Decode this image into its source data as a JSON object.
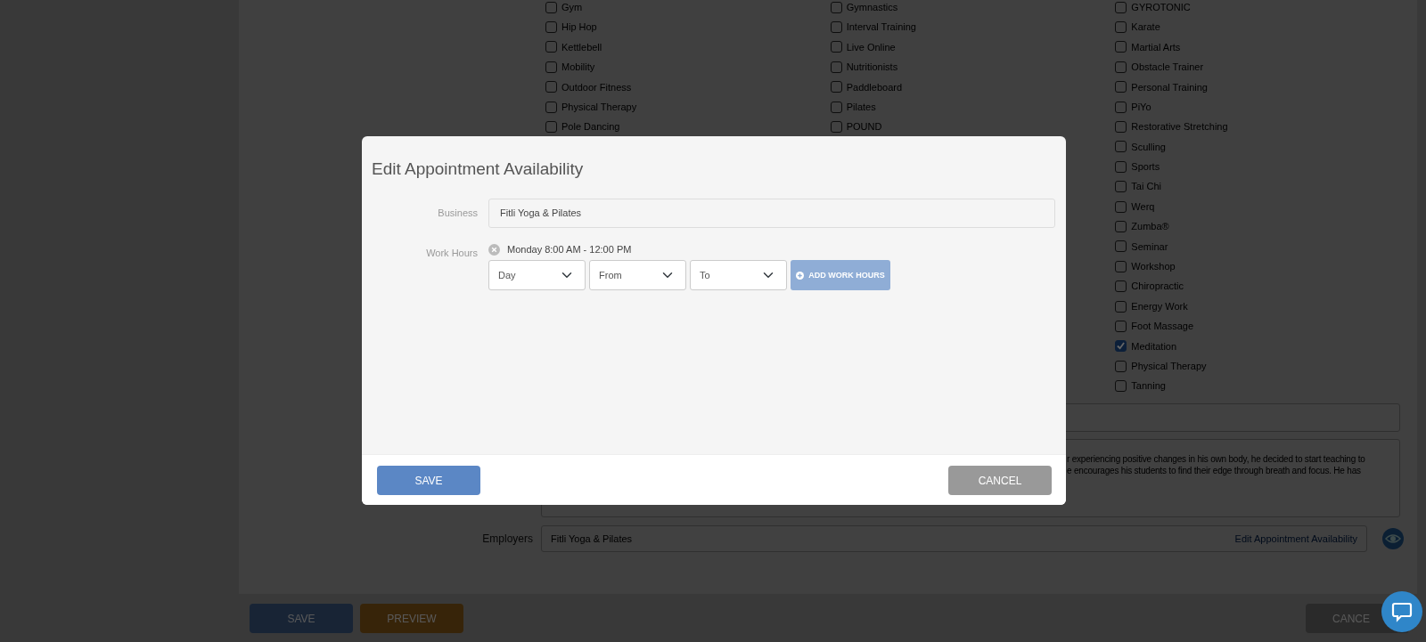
{
  "page": {
    "specialty_columns": [
      {
        "items": [
          {
            "label": "Gym",
            "checked": false
          },
          {
            "label": "Hip Hop",
            "checked": false
          },
          {
            "label": "Kettlebell",
            "checked": false
          },
          {
            "label": "Mobility",
            "checked": false
          },
          {
            "label": "Outdoor Fitness",
            "checked": false
          },
          {
            "label": "Physical Therapy",
            "checked": false
          },
          {
            "label": "Pole Dancing",
            "checked": false
          }
        ]
      },
      {
        "items": [
          {
            "label": "Gymnastics",
            "checked": false
          },
          {
            "label": "Interval Training",
            "checked": false
          },
          {
            "label": "Live Online",
            "checked": false
          },
          {
            "label": "Nutritionists",
            "checked": false
          },
          {
            "label": "Paddleboard",
            "checked": false
          },
          {
            "label": "Pilates",
            "checked": false
          },
          {
            "label": "POUND",
            "checked": false
          }
        ]
      },
      {
        "items": [
          {
            "label": "GYROTONIC",
            "checked": false
          },
          {
            "label": "Karate",
            "checked": false
          },
          {
            "label": "Martial Arts",
            "checked": false
          },
          {
            "label": "Obstacle Trainer",
            "checked": false
          },
          {
            "label": "Personal Training",
            "checked": false
          },
          {
            "label": "PiYo",
            "checked": false
          },
          {
            "label": "Restorative Stretching",
            "checked": false
          },
          {
            "label": "Sculling",
            "checked": false
          },
          {
            "label": "Sports",
            "checked": false
          },
          {
            "label": "Tai Chi",
            "checked": false
          },
          {
            "label": "Werq",
            "checked": false
          },
          {
            "label": "Zumba®",
            "checked": false
          },
          {
            "label": "Seminar",
            "checked": false
          },
          {
            "label": "Workshop",
            "checked": false
          },
          {
            "label": "Chiropractic",
            "checked": false
          },
          {
            "label": "Energy Work",
            "checked": false
          },
          {
            "label": "Foot Massage",
            "checked": false
          },
          {
            "label": "Meditation",
            "checked": true
          },
          {
            "label": "Physical Therapy",
            "checked": false
          },
          {
            "label": "Tanning",
            "checked": false
          }
        ]
      }
    ],
    "bio": {
      "lines": [
        "r experiencing positive changes in his own body, he decided to start teaching to",
        "e encourages his students to find their edge through breath and focus. He has"
      ]
    },
    "employers": {
      "label": "Employers",
      "value": "Fitli Yoga & Pilates",
      "link": "Edit Appointment Availability"
    },
    "footer_buttons": [
      {
        "label": "SAVE",
        "kind": "primary"
      },
      {
        "label": "PREVIEW",
        "kind": "warning"
      },
      {
        "label": "CANCE",
        "kind": "secondary"
      }
    ]
  },
  "modal": {
    "title": "Edit Appointment Availability",
    "business": {
      "label": "Business",
      "value": "Fitli Yoga & Pilates"
    },
    "work_hours": {
      "label": "Work Hours",
      "entries": [
        "Monday 8:00 AM - 12:00 PM"
      ],
      "selects": [
        {
          "value": "Day"
        },
        {
          "value": "From"
        },
        {
          "value": "To"
        }
      ],
      "add_button": "ADD WORK HOURS"
    },
    "buttons": [
      {
        "label": "SAVE",
        "kind": "primary"
      },
      {
        "label": "CANCEL",
        "kind": "secondary"
      }
    ]
  }
}
